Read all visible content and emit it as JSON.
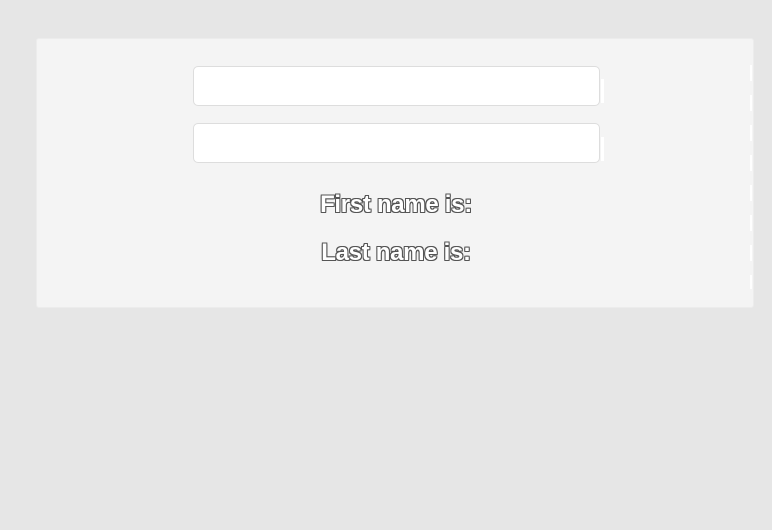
{
  "form": {
    "first_name": {
      "value": "",
      "placeholder": ""
    },
    "last_name": {
      "value": "",
      "placeholder": ""
    }
  },
  "output": {
    "first_name_label": "First name is:",
    "last_name_label": "Last name is:"
  }
}
